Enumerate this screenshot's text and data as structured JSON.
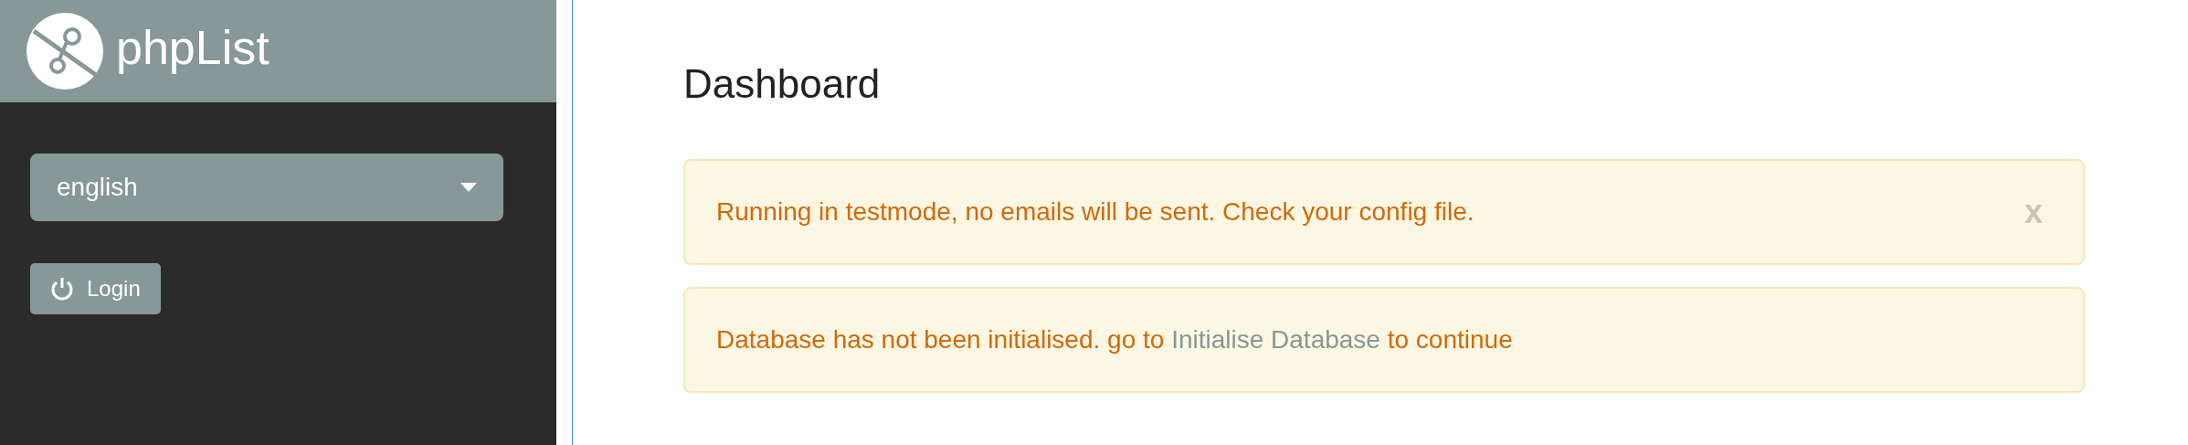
{
  "sidebar": {
    "logo_text": "phpList",
    "language_select": {
      "value": "english"
    },
    "login_button": "Login"
  },
  "main": {
    "title": "Dashboard",
    "alerts": [
      {
        "kind": "dismissible",
        "text": "Running in testmode, no emails will be sent. Check your config file.",
        "close": "x"
      },
      {
        "kind": "link",
        "before": "Database has not been initialised. go to ",
        "link": "Initialise Database",
        "after": " to continue"
      }
    ]
  }
}
